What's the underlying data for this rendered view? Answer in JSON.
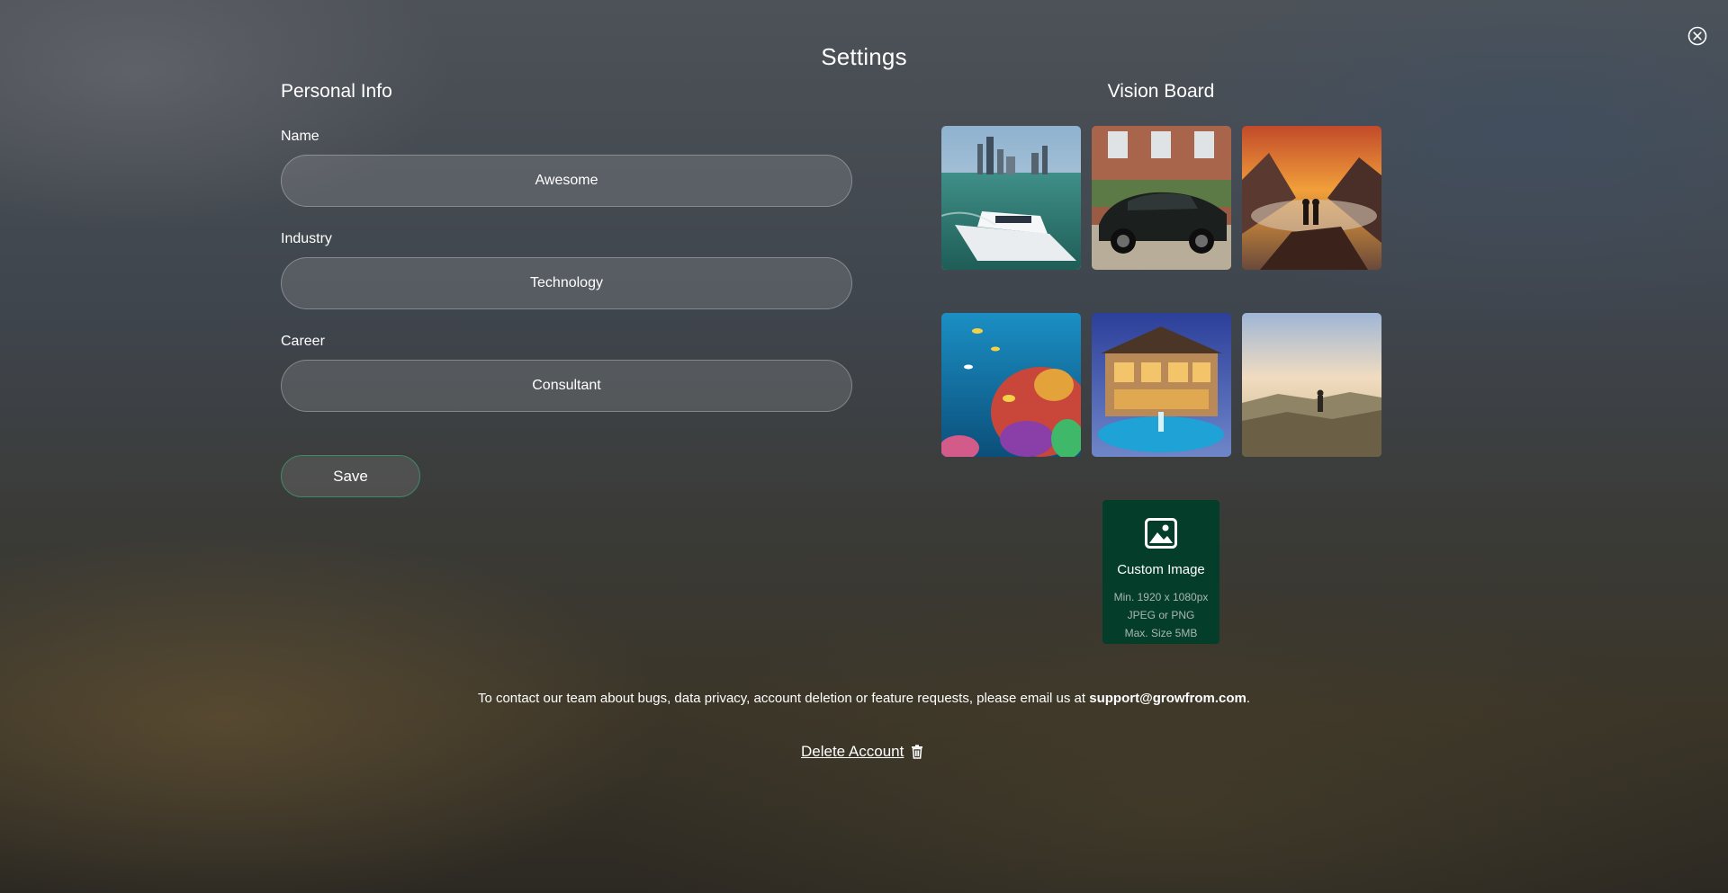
{
  "page": {
    "title": "Settings"
  },
  "close": {
    "icon": "close-circle-icon"
  },
  "personal_info": {
    "title": "Personal Info",
    "fields": [
      {
        "label": "Name",
        "value": "Awesome"
      },
      {
        "label": "Industry",
        "value": "Technology"
      },
      {
        "label": "Career",
        "value": "Consultant"
      }
    ],
    "save_label": "Save"
  },
  "vision_board": {
    "title": "Vision Board",
    "images": [
      {
        "subject": "yacht-near-city-skyline"
      },
      {
        "subject": "black-sports-car"
      },
      {
        "subject": "couple-on-mountain-at-sunset"
      },
      {
        "subject": "coral-reef"
      },
      {
        "subject": "luxury-house-with-pool"
      },
      {
        "subject": "person-on-hill-at-sunrise"
      }
    ],
    "custom_image": {
      "icon": "image-icon",
      "label": "Custom Image",
      "notes": [
        "Min. 1920 x 1080px",
        "JPEG or PNG",
        "Max. Size 5MB"
      ]
    }
  },
  "footer": {
    "contact_text": "To contact our team about bugs, data privacy, account deletion or feature requests, please email us at ",
    "contact_email": "support@growfrom.com",
    "contact_suffix": ".",
    "delete_label": "Delete Account",
    "delete_icon": "trash-icon"
  },
  "colors": {
    "custom_image_bg": "#053d2b",
    "save_border": "#3f8a67"
  }
}
